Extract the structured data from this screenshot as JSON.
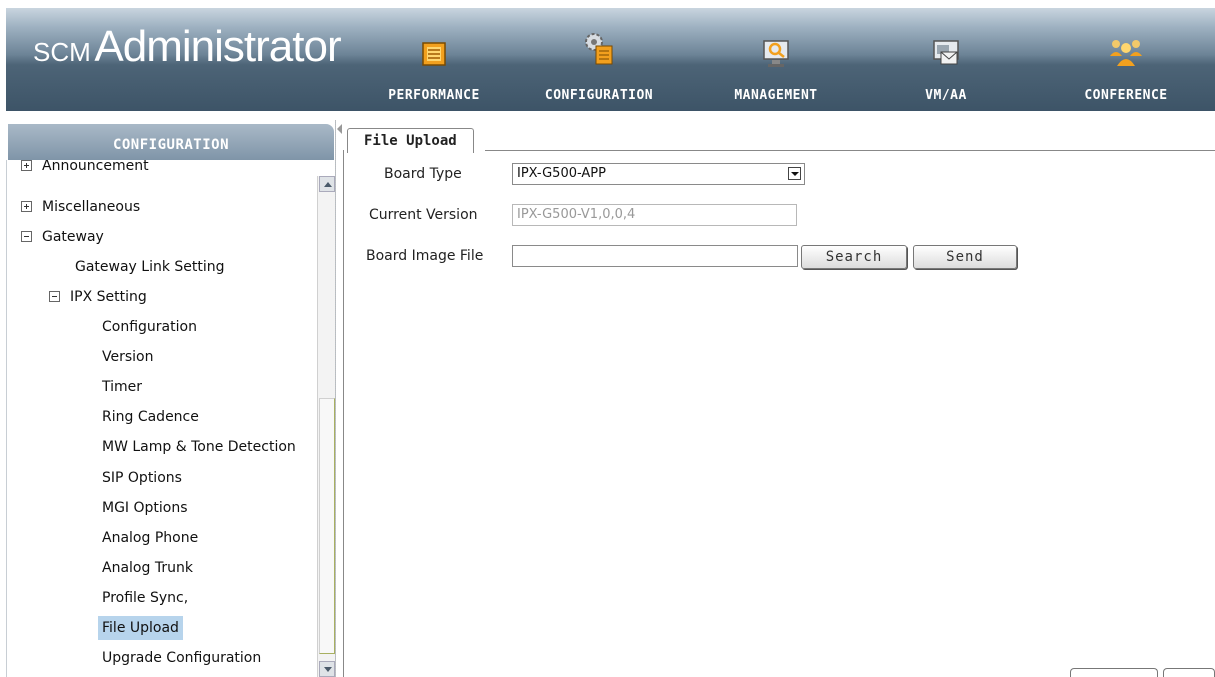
{
  "app": {
    "brand_small": "SCM",
    "brand_large": "Administrator"
  },
  "nav": [
    {
      "label": "PERFORMANCE",
      "icon": "performance-icon"
    },
    {
      "label": "CONFIGURATION",
      "icon": "configuration-icon"
    },
    {
      "label": "MANAGEMENT",
      "icon": "management-icon"
    },
    {
      "label": "VM/AA",
      "icon": "vmaa-icon"
    },
    {
      "label": "CONFERENCE",
      "icon": "conference-icon"
    }
  ],
  "sidebar": {
    "title": "CONFIGURATION",
    "items": [
      {
        "label": "Announcement",
        "toggle": "plus"
      },
      {
        "label": "Miscellaneous",
        "toggle": "plus"
      },
      {
        "label": "Gateway",
        "toggle": "minus"
      },
      {
        "label": "Gateway Link Setting"
      },
      {
        "label": "IPX Setting",
        "toggle": "minus"
      },
      {
        "label": "Configuration"
      },
      {
        "label": "Version"
      },
      {
        "label": "Timer"
      },
      {
        "label": "Ring Cadence"
      },
      {
        "label": "MW Lamp & Tone Detection"
      },
      {
        "label": "SIP Options"
      },
      {
        "label": "MGI Options"
      },
      {
        "label": "Analog Phone"
      },
      {
        "label": "Analog Trunk"
      },
      {
        "label": "Profile Sync,"
      },
      {
        "label": "File Upload",
        "selected": true
      },
      {
        "label": "Upgrade Configuration"
      }
    ]
  },
  "main": {
    "tab": "File Upload",
    "board_type": {
      "label": "Board Type",
      "value": "IPX-G500-APP"
    },
    "current_version": {
      "label": "Current Version",
      "value": "IPX-G500-V1,0,0,4"
    },
    "board_image": {
      "label": "Board Image File",
      "value": ""
    },
    "search_label": "Search",
    "send_label": "Send"
  },
  "colors": {
    "header_top": "#c9d5df",
    "header_bottom": "#3d5467",
    "selected": "#b7d4ec",
    "icon_orange": "#f0a020"
  }
}
